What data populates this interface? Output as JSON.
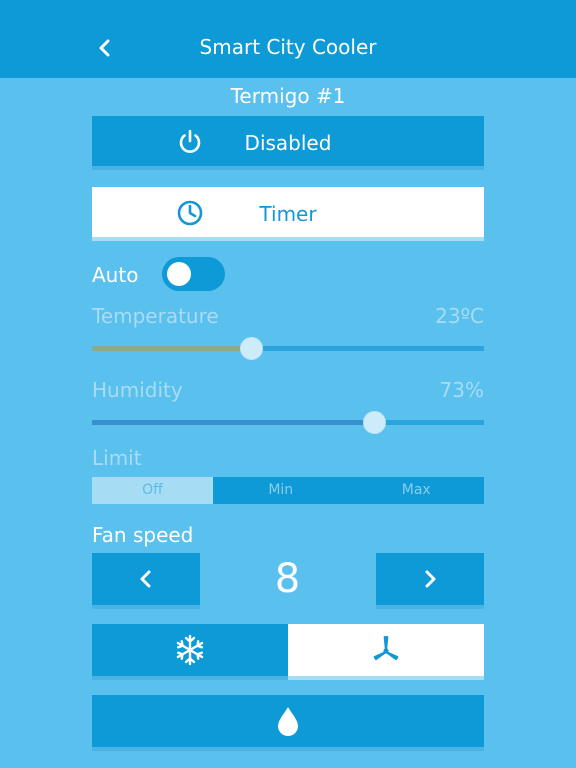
{
  "header": {
    "title": "Smart City Cooler",
    "back_icon": "chevron-left-icon"
  },
  "device": {
    "name": "Termigo #1"
  },
  "power_button": {
    "label": "Disabled",
    "icon": "power-icon"
  },
  "timer_button": {
    "label": "Timer",
    "icon": "clock-icon"
  },
  "auto": {
    "label": "Auto",
    "enabled": false
  },
  "temperature": {
    "label": "Temperature",
    "value_text": "23ºC",
    "level": 0.405
  },
  "humidity": {
    "label": "Humidity",
    "value_text": "73%",
    "level": 0.72
  },
  "limit": {
    "label": "Limit",
    "options": [
      "Off",
      "Min",
      "Max"
    ],
    "selected": "Off"
  },
  "fan_speed": {
    "label": "Fan speed",
    "value": "8",
    "decrease_icon": "chevron-left-icon",
    "increase_icon": "chevron-right-icon"
  },
  "modes": {
    "cool_icon": "snowflake-icon",
    "fan_icon": "fan-icon",
    "selected": "fan",
    "humidify_icon": "water-drop-icon"
  },
  "colors": {
    "background": "#5ac0ee",
    "primary": "#0d9ad6",
    "white": "#ffffff",
    "temperature_fill": "#8aac8c",
    "humidity_fill": "#3a8fd0"
  }
}
